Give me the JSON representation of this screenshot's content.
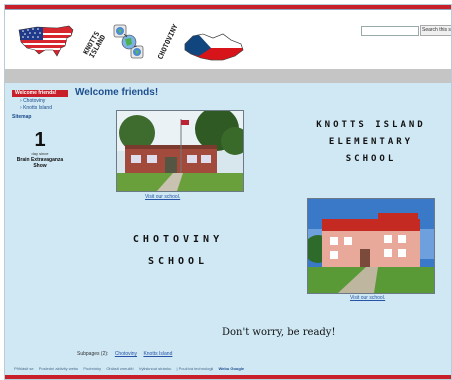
{
  "header": {
    "logo_left_text": "KNOTTS ISLAND",
    "logo_right_text": "CHOTOVINY",
    "search": {
      "placeholder": "",
      "button_label": "Search this si"
    }
  },
  "sidebar": {
    "items": [
      {
        "label": "Welcome friends!",
        "active": true
      },
      {
        "label": "Chotoviny",
        "active": false
      },
      {
        "label": "Knotts Island",
        "active": false
      }
    ],
    "sitemap_label": "Sitemap"
  },
  "countdown": {
    "number": "1",
    "unit": "day since",
    "event": "Brain Extravaganza Show"
  },
  "main": {
    "title": "Welcome friends!",
    "ki_logo_lines": [
      "KNOTTS ISLAND",
      "ELEMENTARY",
      "SCHOOL"
    ],
    "ki_link": "Visit our school.",
    "ch_logo_lines": [
      "CHOTOVINY",
      "SCHOOL"
    ],
    "ch_link": "Visit our school.",
    "slogan": "Don't worry, be ready!",
    "subpages_label": "Subpages (2):",
    "subpages": [
      "Chotoviny",
      "Knotts Island"
    ]
  },
  "footer": {
    "items": [
      "Přihlásit se",
      "Poslední aktivity webu",
      "Podmínky",
      "Ohlásit zneužití",
      "Vytisknout stránku"
    ],
    "powered_text": "Používá technologii",
    "powered_brand": "Webu Google"
  },
  "colors": {
    "accent_red": "#c8202a",
    "page_bg": "#cfe8f4",
    "link": "#2653a6",
    "title": "#1f4f8f"
  }
}
